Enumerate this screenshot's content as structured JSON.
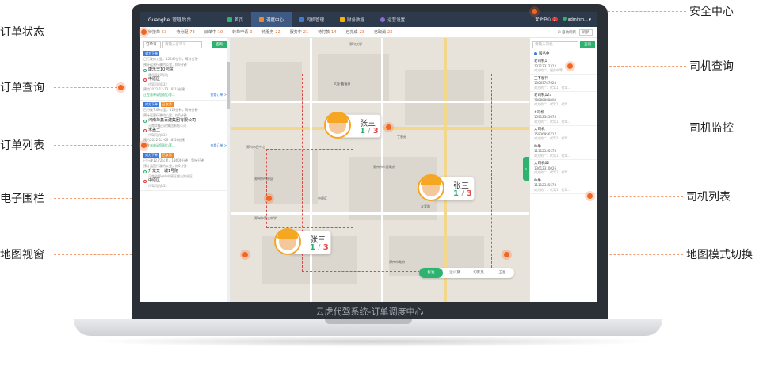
{
  "callouts_left": [
    {
      "id": "order-status",
      "label": "订单状态"
    },
    {
      "id": "order-query",
      "label": "订单查询"
    },
    {
      "id": "order-list",
      "label": "订单列表"
    },
    {
      "id": "geo-fence",
      "label": "电子围栏"
    },
    {
      "id": "map-view",
      "label": "地图视窗"
    }
  ],
  "callouts_right": [
    {
      "id": "security-center",
      "label": "安全中心"
    },
    {
      "id": "driver-query",
      "label": "司机查询"
    },
    {
      "id": "driver-monitor",
      "label": "司机监控"
    },
    {
      "id": "driver-list",
      "label": "司机列表"
    },
    {
      "id": "map-mode-switch",
      "label": "地图模式切换"
    }
  ],
  "caption": "云虎代驾系统-订单调度中心",
  "app": {
    "brand": "Guanghe",
    "brand_sub": "管理后台",
    "nav": [
      {
        "label": "首页",
        "active": false,
        "color": "#2db36f"
      },
      {
        "label": "调度中心",
        "active": true,
        "color": "#f08a24"
      },
      {
        "label": "司机管理",
        "active": false,
        "color": "#3d7bd8"
      },
      {
        "label": "财务数据",
        "active": false,
        "color": "#f5b400"
      },
      {
        "label": "运营设置",
        "active": false,
        "color": "#8a6bd8"
      }
    ],
    "security": "安全中心",
    "security_badge": "2",
    "user": "adminm..."
  },
  "status_tabs": [
    {
      "label": "待接单",
      "count": "53"
    },
    {
      "label": "待分配",
      "count": "73"
    },
    {
      "label": "派单中",
      "count": "10"
    },
    {
      "label": "转单申请",
      "count": "0"
    },
    {
      "label": "待服务",
      "count": "22"
    },
    {
      "label": "服务中",
      "count": "21"
    },
    {
      "label": "待付款",
      "count": "14"
    },
    {
      "label": "已完成",
      "count": "23"
    },
    {
      "label": "已取消",
      "count": "23"
    }
  ],
  "refresh": {
    "label": "自动刷新",
    "button": "刷新"
  },
  "order_search": {
    "select": "订单号",
    "placeholder": "请输入订单号",
    "button": "查询"
  },
  "orders": [
    {
      "tag": "对方下单",
      "tag2": "",
      "meta": "已行驶约公里，12549分钟，等待分钟",
      "meta2": "预计运营行驶约公里，约0分钟",
      "from": "康乐里10号院",
      "from_sub": "康乐里10号院",
      "to": "中原区",
      "to_sub": "代驾司机R32",
      "time": "预约2022-12-13 18:15创建",
      "status": "正在派单请您耐心等...",
      "action": "查看订单 >"
    },
    {
      "tag": "对方下单",
      "tag2": "已取消",
      "meta": "已行驶7.09公里，129分钟，等待分钟",
      "meta2": "预计运营行驶约公里，约0分钟",
      "from": "河南华鑫百建集团有限公司",
      "from_sub": "河南华鑫百建集团有限公司",
      "to": "米盖王",
      "to_sub": "代驾司机R32",
      "time": "预约2022-12-06 18:53创建",
      "status": "正在派单请您耐心等...",
      "action": "查看订单 >"
    },
    {
      "tag": "对方下单",
      "tag2": "已取消",
      "meta": "已行驶12.72公里，18606分钟，等待分钟",
      "meta2": "预计运营行驶约公里，约0分钟",
      "from": "升龙又一城1号院",
      "from_sub": "河南省郑州市中原区嵩山路社区",
      "to": "中原区",
      "to_sub": "代驾司机R32",
      "time": "",
      "status": "",
      "action": ""
    }
  ],
  "map": {
    "labels": [
      "郑州大学",
      "大厦·鑫福源",
      "郑州市民中心",
      "郑州市中原区",
      "丁香苑",
      "郑州市人民政府",
      "友爱路",
      "郑州市第三中学",
      "中原区",
      "郑州市政府"
    ],
    "modes": [
      {
        "label": "标准",
        "on": true
      },
      {
        "label": "远山黛",
        "on": false
      },
      {
        "label": "幻影黑",
        "on": false
      }
    ],
    "mode_extra": "卫星",
    "drivers": [
      {
        "name": "张三",
        "a": "1",
        "b": "3",
        "a_color": "#2db36f"
      },
      {
        "name": "张三",
        "a": "1",
        "b": "3",
        "a_color": "#2db36f"
      },
      {
        "name": "张三",
        "a": "1",
        "b": "3",
        "a_color": "#2db36f"
      }
    ]
  },
  "driver_search": {
    "placeholder": "请输入司机",
    "button": "查询"
  },
  "driver_filter": "服务中",
  "drivers": [
    {
      "name": "老司机1",
      "phone": "13312312312",
      "desc": "对方的广，服务中等"
    },
    {
      "name": "王不留行",
      "phone": "13663787624",
      "desc": "对方的广，代驾1，代驾..."
    },
    {
      "name": "老司机123",
      "phone": "18888888000",
      "desc": "对方的广，代驾1，代驾..."
    },
    {
      "name": "#司机",
      "phone": "15912345678",
      "desc": "对方的广，代驾1，代驾..."
    },
    {
      "name": "大司机",
      "phone": "15836956717",
      "desc": "对方的广，代驾1，代驾..."
    },
    {
      "name": "牛牛",
      "phone": "11112345678",
      "desc": "对方的广，代驾1，代驾..."
    },
    {
      "name": "大司机02",
      "phone": "13612310026",
      "desc": "对方的广，代驾1，代驾..."
    },
    {
      "name": "牛牛",
      "phone": "11112345678",
      "desc": "对方的广，代驾1，代驾..."
    }
  ]
}
